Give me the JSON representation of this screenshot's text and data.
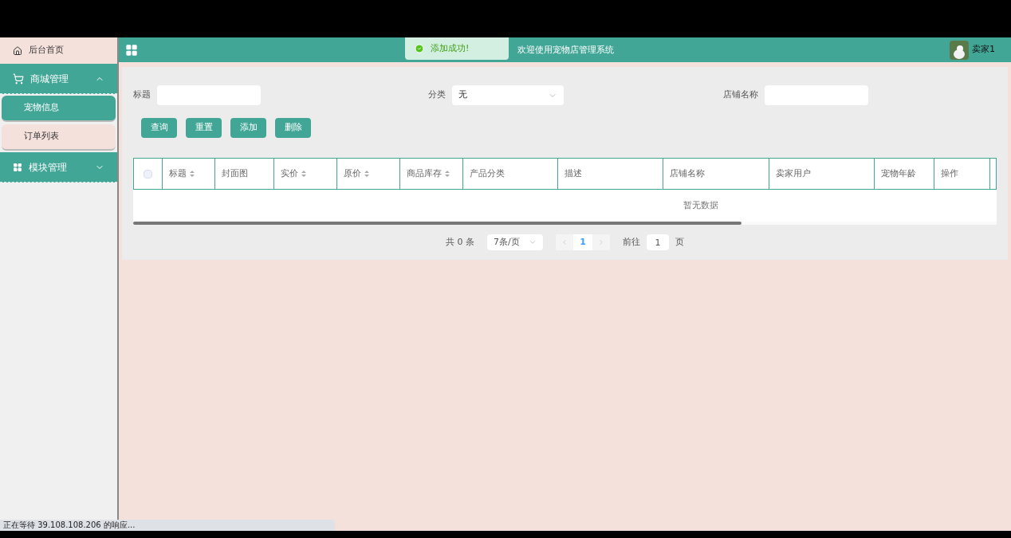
{
  "sidebar": {
    "items": [
      {
        "label": "后台首页",
        "kind": "link"
      },
      {
        "label": "商城管理",
        "kind": "group",
        "expanded": true,
        "children": [
          {
            "label": "宠物信息",
            "selected": true
          },
          {
            "label": "订单列表",
            "selected": false
          }
        ]
      },
      {
        "label": "模块管理",
        "kind": "group",
        "expanded": false
      }
    ]
  },
  "header": {
    "title": "欢迎使用宠物店管理系统",
    "user": "卖家1"
  },
  "toast": {
    "message": "添加成功!"
  },
  "filters": [
    {
      "label": "标题",
      "kind": "input"
    },
    {
      "label": "分类",
      "kind": "select",
      "value": "无"
    },
    {
      "label": "店铺名称",
      "kind": "input"
    }
  ],
  "buttons": [
    "查询",
    "重置",
    "添加",
    "删除"
  ],
  "table": {
    "select_all": {
      "checked": false
    },
    "columns": [
      {
        "label": "标题",
        "sortable": true
      },
      {
        "label": "封面图",
        "sortable": false
      },
      {
        "label": "实价",
        "sortable": true
      },
      {
        "label": "原价",
        "sortable": true
      },
      {
        "label": "商品库存",
        "sortable": true
      },
      {
        "label": "产品分类",
        "sortable": false
      },
      {
        "label": "描述",
        "sortable": false
      },
      {
        "label": "店铺名称",
        "sortable": false
      },
      {
        "label": "卖家用户",
        "sortable": false
      },
      {
        "label": "宠物年龄",
        "sortable": false
      },
      {
        "label": "操作",
        "sortable": false
      }
    ],
    "empty_text": "暂无数据"
  },
  "pagination": {
    "total": "共 0 条",
    "page_size": "7条/页",
    "pages": [
      {
        "label": "1",
        "selected": true
      }
    ],
    "goto_label": "前往",
    "goto_value": "1",
    "goto_suffix": "页"
  },
  "status_bar": "正在等待 39.108.108.206 的响应..."
}
